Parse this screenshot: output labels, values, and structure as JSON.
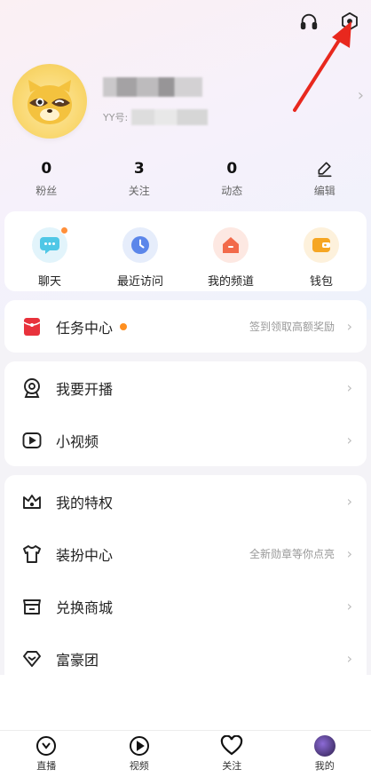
{
  "header": {
    "headphone_icon": "headphone-icon",
    "settings_icon": "settings-icon"
  },
  "profile": {
    "yy_label": "YY号:"
  },
  "stats": [
    {
      "value": "0",
      "label": "粉丝"
    },
    {
      "value": "3",
      "label": "关注"
    },
    {
      "value": "0",
      "label": "动态"
    },
    {
      "value": "",
      "label": "编辑"
    }
  ],
  "quick": [
    {
      "label": "聊天",
      "icon": "chat-icon",
      "color": "#4fc7e6",
      "bg": "#e2f4fb"
    },
    {
      "label": "最近访问",
      "icon": "clock-icon",
      "color": "#5b86ea",
      "bg": "#e6edfb"
    },
    {
      "label": "我的频道",
      "icon": "channel-house-icon",
      "color": "#f26a4a",
      "bg": "#fde8e2"
    },
    {
      "label": "钱包",
      "icon": "wallet-icon",
      "color": "#f6a623",
      "bg": "#fdf1dc"
    }
  ],
  "task": {
    "label": "任务中心",
    "hint": "签到领取高额奖励"
  },
  "live": [
    {
      "label": "我要开播"
    },
    {
      "label": "小视频"
    }
  ],
  "more": [
    {
      "label": "我的特权",
      "hint": ""
    },
    {
      "label": "装扮中心",
      "hint": "全新勋章等你点亮"
    },
    {
      "label": "兑换商城",
      "hint": ""
    },
    {
      "label": "富豪团",
      "hint": ""
    }
  ],
  "tabs": [
    {
      "label": "直播"
    },
    {
      "label": "视频"
    },
    {
      "label": "关注"
    },
    {
      "label": "我的"
    }
  ],
  "colors": {
    "accent_orange": "#ff8f1f",
    "red_task": "#e8323c",
    "arrow_red": "#e8281e"
  }
}
